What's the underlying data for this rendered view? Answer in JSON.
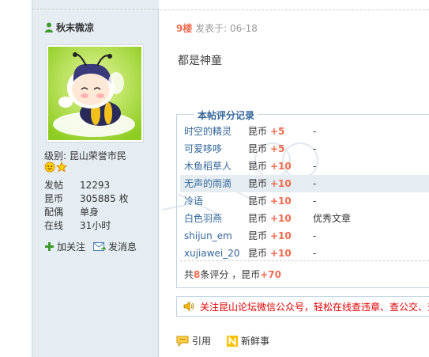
{
  "user": {
    "name": "秋末微凉",
    "level_text": "级别: 昆山荣誉市民",
    "stats": [
      {
        "key": "发帖",
        "value": "12293"
      },
      {
        "key": "昆币",
        "value": "305885 枚"
      },
      {
        "key": "配偶",
        "value": "单身"
      },
      {
        "key": "在线",
        "value": "31小时"
      }
    ],
    "actions": {
      "follow": "加关注",
      "message": "发消息"
    }
  },
  "post": {
    "floor": "9楼",
    "meta": " 发表于: 06-18",
    "body": "都是神童"
  },
  "rating": {
    "legend": "本帖评分记录",
    "rows": [
      {
        "user": "时空的精灵",
        "currency": "昆币",
        "points": "+5",
        "reason": "-"
      },
      {
        "user": "可爱哆哆",
        "currency": "昆币",
        "points": "+5",
        "reason": "-"
      },
      {
        "user": "木鱼稻草人",
        "currency": "昆币",
        "points": "+10",
        "reason": "-"
      },
      {
        "user": "无声的雨滴",
        "currency": "昆币",
        "points": "+10",
        "reason": "-"
      },
      {
        "user": "冷语",
        "currency": "昆币",
        "points": "+10",
        "reason": "-"
      },
      {
        "user": "白色羽燕",
        "currency": "昆币",
        "points": "+10",
        "reason": "优秀文章"
      },
      {
        "user": "shijun_em",
        "currency": "昆币",
        "points": "+10",
        "reason": "-"
      },
      {
        "user": "xujiawei_20",
        "currency": "昆币",
        "points": "+10",
        "reason": "-"
      }
    ],
    "summary_prefix": "共",
    "summary_count": "8",
    "summary_mid": "条评分 ，昆币",
    "summary_total": "+70"
  },
  "notice": {
    "text": "关注昆山论坛微信公众号，轻松在线查违章、查公交、查"
  },
  "bottom": {
    "quote": "引用",
    "fresh": "新鲜事"
  },
  "colors": {
    "sidebar_bg": "#e5edf2",
    "border": "#c2d5e3",
    "link": "#336699",
    "accent": "#f26c4f",
    "notice": "#e00000"
  }
}
